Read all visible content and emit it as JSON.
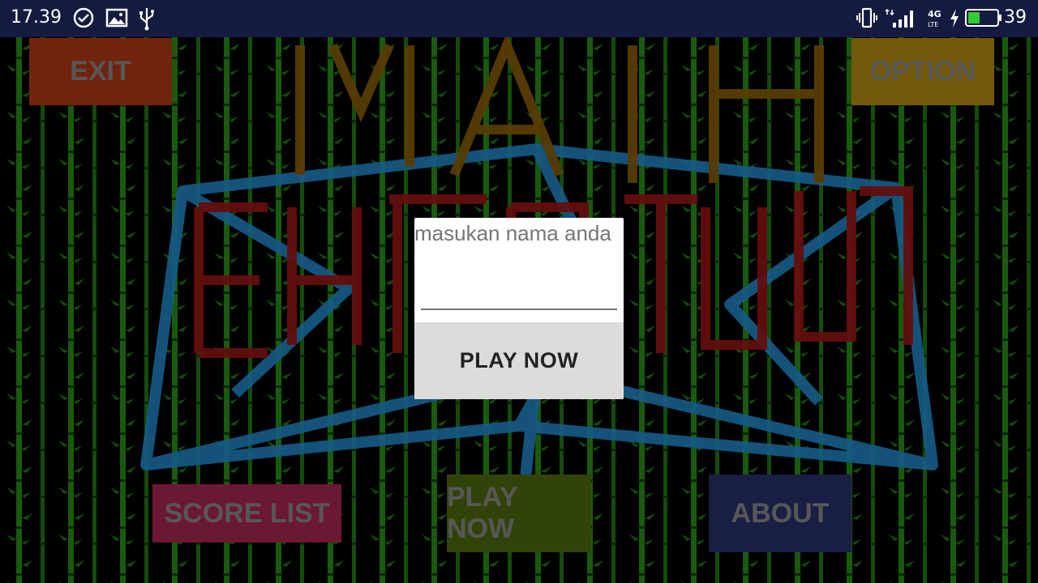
{
  "status_bar": {
    "time": "17.39",
    "network": "4G LTE",
    "battery_level": "39",
    "battery_color": "#33cc33"
  },
  "menu": {
    "exit_label": "EXIT",
    "option_label": "OPTION",
    "score_list_label": "SCORE LIST",
    "play_now_label": "PLAY NOW",
    "about_label": "ABOUT"
  },
  "dialog": {
    "title": "masukan nama anda",
    "name_value": "",
    "play_label": "PLAY NOW"
  }
}
